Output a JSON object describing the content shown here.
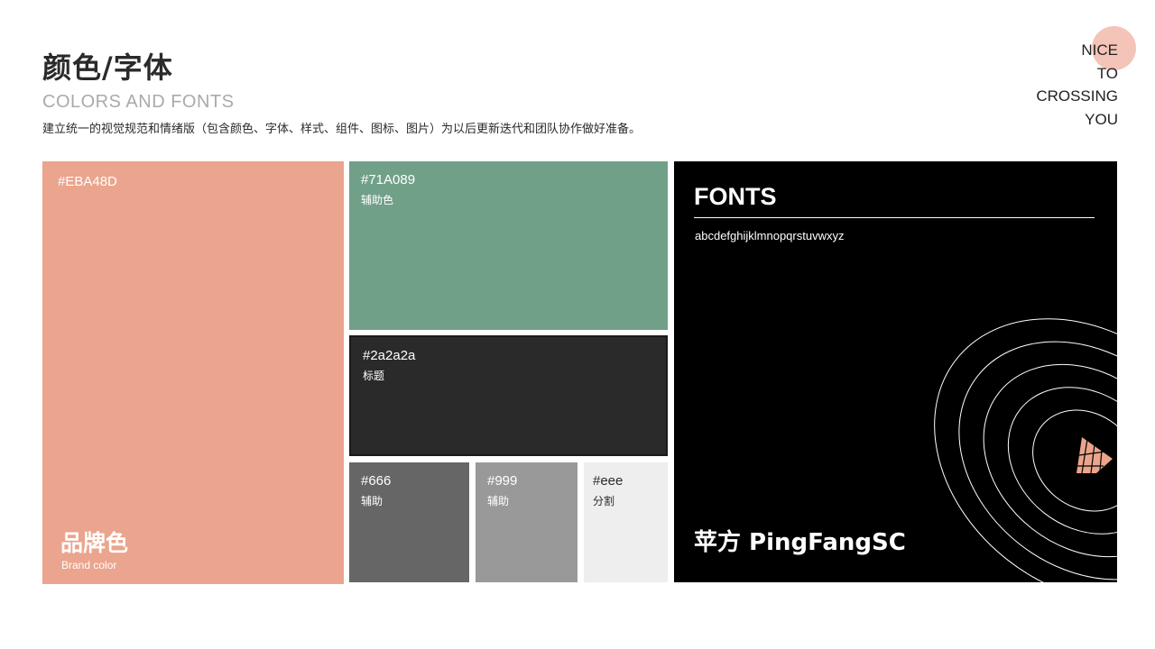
{
  "header": {
    "title": "颜色/字体",
    "subtitle": "COLORS AND FONTS",
    "description": "建立统一的视觉规范和情绪版（包含颜色、字体、样式、组件、图标、图片）为以后更新迭代和团队协作做好准备。"
  },
  "tagline": {
    "lines": [
      "NICE",
      "TO",
      "CROSSING",
      "YOU"
    ],
    "accent": "#f3c4b7"
  },
  "palette": {
    "brand": {
      "hex": "#EBA48D",
      "name": "品牌色",
      "name_en": "Brand color",
      "color": "#eba48d"
    },
    "secondary": {
      "hex": "#71A089",
      "role": "辅助色",
      "color": "#71a089"
    },
    "title": {
      "hex": "#2a2a2a",
      "role": "标题",
      "color": "#2a2a2a"
    },
    "aux1": {
      "hex": "#666",
      "role": "辅助",
      "color": "#666666"
    },
    "aux2": {
      "hex": "#999",
      "role": "辅助",
      "color": "#999999"
    },
    "divider": {
      "hex": "#eee",
      "role": "分割",
      "color": "#eeeeee"
    }
  },
  "fonts": {
    "heading": "FONTS",
    "alphabet": "abcdefghijklmnopqrstuvwxyz",
    "sample": "苹方  PingFangSC",
    "background": "#000000",
    "decoration_icon": "concentric-rings-with-pink-cone"
  }
}
